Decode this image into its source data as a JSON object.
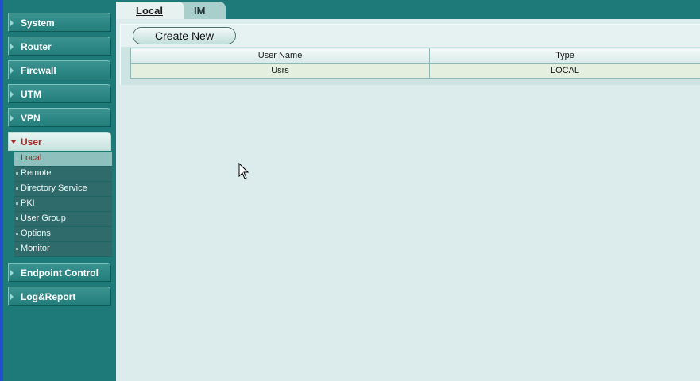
{
  "sidebar": {
    "menus": [
      {
        "label": "System"
      },
      {
        "label": "Router"
      },
      {
        "label": "Firewall"
      },
      {
        "label": "UTM"
      },
      {
        "label": "VPN"
      },
      {
        "label": "User"
      }
    ],
    "user_submenu": [
      {
        "label": "Local"
      },
      {
        "label": "Remote"
      },
      {
        "label": "Directory Service"
      },
      {
        "label": "PKI"
      },
      {
        "label": "User Group"
      },
      {
        "label": "Options"
      },
      {
        "label": "Monitor"
      }
    ],
    "menus_after": [
      {
        "label": "Endpoint Control"
      },
      {
        "label": "Log&Report"
      }
    ]
  },
  "tabs": [
    {
      "label": "Local",
      "active": true
    },
    {
      "label": "IM",
      "active": false
    }
  ],
  "toolbar": {
    "create_label": "Create New"
  },
  "table": {
    "headers": [
      "User Name",
      "Type"
    ],
    "rows": [
      [
        "Usrs",
        "LOCAL"
      ]
    ]
  },
  "colors": {
    "sidebar_bg": "#1e7a78",
    "content_bg": "#dcebec",
    "active_menu_text": "#a82b2b"
  }
}
